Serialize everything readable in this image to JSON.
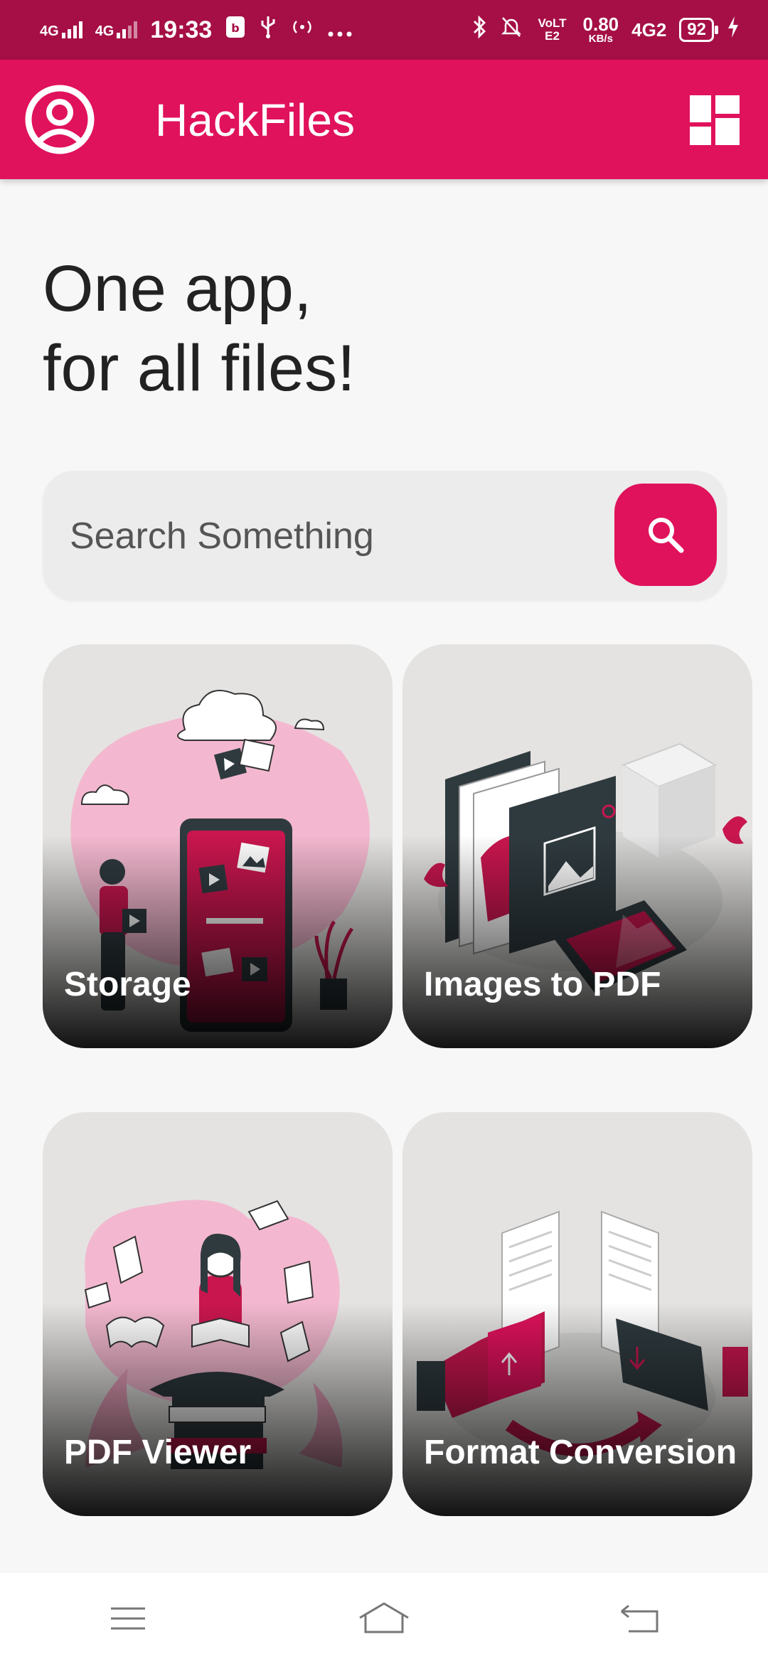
{
  "status_bar": {
    "net1": "4G",
    "net2": "4G",
    "time": "19:33",
    "volte": "VoLTE2",
    "speed_value": "0.80",
    "speed_unit": "KB/s",
    "net3": "4G2",
    "battery": "92",
    "icons": [
      "sim-icon",
      "usb-icon",
      "hotspot-icon",
      "more-dots-icon",
      "bluetooth-icon",
      "mute-bell-icon",
      "charging-icon"
    ]
  },
  "app_bar": {
    "title": "HackFiles",
    "icons": [
      "account-circle-icon",
      "dashboard-layout-icon"
    ]
  },
  "headline": {
    "line1": "One app,",
    "line2": "for all files!"
  },
  "search": {
    "placeholder": "Search Something",
    "icon": "search-icon"
  },
  "cards": [
    {
      "label": "Storage"
    },
    {
      "label": "Images to PDF"
    },
    {
      "label": "PDF Viewer"
    },
    {
      "label": "Format Conversion"
    }
  ],
  "nav": {
    "icons": [
      "menu-icon",
      "home-icon",
      "back-icon"
    ]
  },
  "colors": {
    "status_bar": "#a50f45",
    "accent": "#e0125c",
    "background": "#f7f7f7",
    "card": "#e4e3e1",
    "illustration_pink": "#f3b8cf",
    "illustration_dark": "#2f3a3f"
  }
}
